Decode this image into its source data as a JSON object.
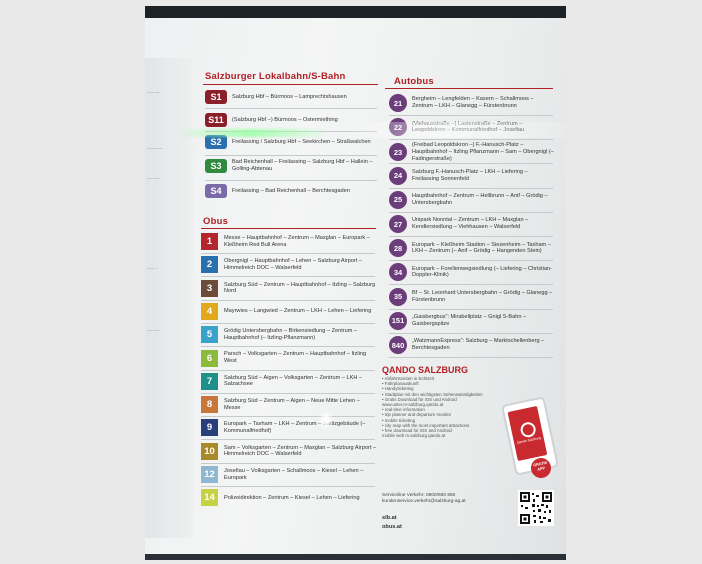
{
  "slb_heading": "Salzburger Lokalbahn/S-Bahn",
  "sbahn": [
    {
      "code": "S1",
      "text": "Salzburg Hbf – Bürmoos – Lamprechtshausen"
    },
    {
      "code": "S11",
      "text": "(Salzburg Hbf –) Bürmoos – Ostermiething"
    },
    {
      "code": "S2",
      "text": "Freilassing / Salzburg Hbf – Seekirchen – Straßwalchen"
    },
    {
      "code": "S3",
      "text": "Bad Reichenhall – Freilassing – Salzburg Hbf – Hallein – Golling-Abtenau"
    },
    {
      "code": "S4",
      "text": "Freilassing – Bad Reichenhall – Berchtesgaden"
    }
  ],
  "obus_heading": "Obus",
  "obus": [
    {
      "num": "1",
      "color": "#b3262c",
      "text": "Messe – Hauptbahnhof – Zentrum – Maxglan – Europark – Kleßheim Red Bull Arena"
    },
    {
      "num": "2",
      "color": "#2a6fb0",
      "text": "Obergnigl – Hauptbahnhof – Lehen – Salzburg Airport – Himmelreich DOC – Walserfeld"
    },
    {
      "num": "3",
      "color": "#6b4b3a",
      "text": "Salzburg Süd – Zentrum – Hauptbahnhof – Itzling – Salzburg Nord"
    },
    {
      "num": "4",
      "color": "#e0a91c",
      "text": "Mayrwies – Langwied – Zentrum – LKH – Lehen – Liefering"
    },
    {
      "num": "5",
      "color": "#3aa3c9",
      "text": "Grödig Untersbergbahn – Birkensiedlung – Zentrum – Hauptbahnhof (– Itzling-Pflanzmann)"
    },
    {
      "num": "6",
      "color": "#8cba3c",
      "text": "Parsch – Volksgarten – Zentrum – Hauptbahnhof – Itzling West"
    },
    {
      "num": "7",
      "color": "#1f8f8a",
      "text": "Salzburg Süd – Aigen – Volksgarten – Zentrum – LKH – Salzachsee"
    },
    {
      "num": "8",
      "color": "#c9763a",
      "text": "Salzburg Süd – Zentrum – Aigen – Neue Mitte Lehen – Messe"
    },
    {
      "num": "9",
      "color": "#27407a",
      "text": "Europark – Taxham – LKH – Zentrum – Justizgebäude (– Kommunalfriedhof)"
    },
    {
      "num": "10",
      "color": "#a88a2a",
      "text": "Sam – Volksgarten – Zentrum – Maxglan – Salzburg Airport – Himmelreich DOC – Walserfeld"
    },
    {
      "num": "12",
      "color": "#8fb7cf",
      "text": "Josefiau – Volksgarten – Schallmoos – Kiesel – Lehen – Europark"
    },
    {
      "num": "14",
      "color": "#c6d145",
      "text": "Polizeidirektion – Zentrum – Kiesel – Lehen – Liefering"
    }
  ],
  "autobus_heading": "Autobus",
  "autobus": [
    {
      "num": "21",
      "text": "Bergheim – Lengfelden – Kasern – Schallmoos – Zentrum – LKH – Glanegg – Fürstenbrunn"
    },
    {
      "num": "22",
      "text": "(Viehausstraße –) Lastenstraße – Zentrum – Leopoldskron – Kommunalfriedhof – Josefiau"
    },
    {
      "num": "23",
      "text": "(Freibad Leopoldskron –) F.-Hanusch-Platz – Hauptbahnhof – Itzling Pflanzmann – Sam – Obergnigl (– Fadingerstraße)"
    },
    {
      "num": "24",
      "text": "Salzburg F.-Hanusch-Platz – LKH – Liefering – Freilassing Sonnenfeld"
    },
    {
      "num": "25",
      "text": "Hauptbahnhof – Zentrum – Hellbrunn – Anif – Grödig – Untersbergbahn"
    },
    {
      "num": "27",
      "text": "Unipark Nonntal – Zentrum – LKH – Maxglan – Kendlersiedlung – Viehhausen – Walserfeld"
    },
    {
      "num": "28",
      "text": "Europark – Kleßheim Stadion – Siezenheim – Taxham – LKH – Zentrum (– Anif – Grödig – Hangenden Stein)"
    },
    {
      "num": "34",
      "text": "Europark – Forellenwegsiedlung (– Liefering – Christian-Doppler-Klinik)"
    },
    {
      "num": "35",
      "text": "Bf – St. Leonhard Untersbergbahn – Grödig – Glanegg – Fürstenbrunn"
    },
    {
      "num": "151",
      "text": "„Gaisbergbus“: Mirabellplatz – Gnigl S-Bahn – Gaisbergspitze"
    },
    {
      "num": "840",
      "text": "„WatzmannExpress“: Salzburg – Marktschellenberg – Berchtesgaden"
    }
  ],
  "qando": {
    "heading": "QANDO SALZBURG",
    "bullets": [
      "• Abfahrtszeiten in Echtzeit",
      "• Fahrplanauskunft",
      "• Handyticketing",
      "• Stadtplan mit den wichtigsten Sehenswürdigkeiten",
      "• Gratis Download für iOS und Android",
      "  www.uster.m-salzburg.qando.at",
      "• real-time information",
      "• trip planner and departure monitor",
      "• mobile ticketing",
      "• city map with the most important attractions",
      "• free download for iOS and Android",
      "  mobile web m.salzburg.qando.at"
    ],
    "phone_label": "Qando Salzburg",
    "gratis": "GRATIS APP"
  },
  "service_line1": "Serviceline Verkehr: 0800/660 660",
  "service_line2": "kundenservice.verkehr@salzburg-ag.at",
  "site1": "slb.at",
  "site2": "obus.at"
}
